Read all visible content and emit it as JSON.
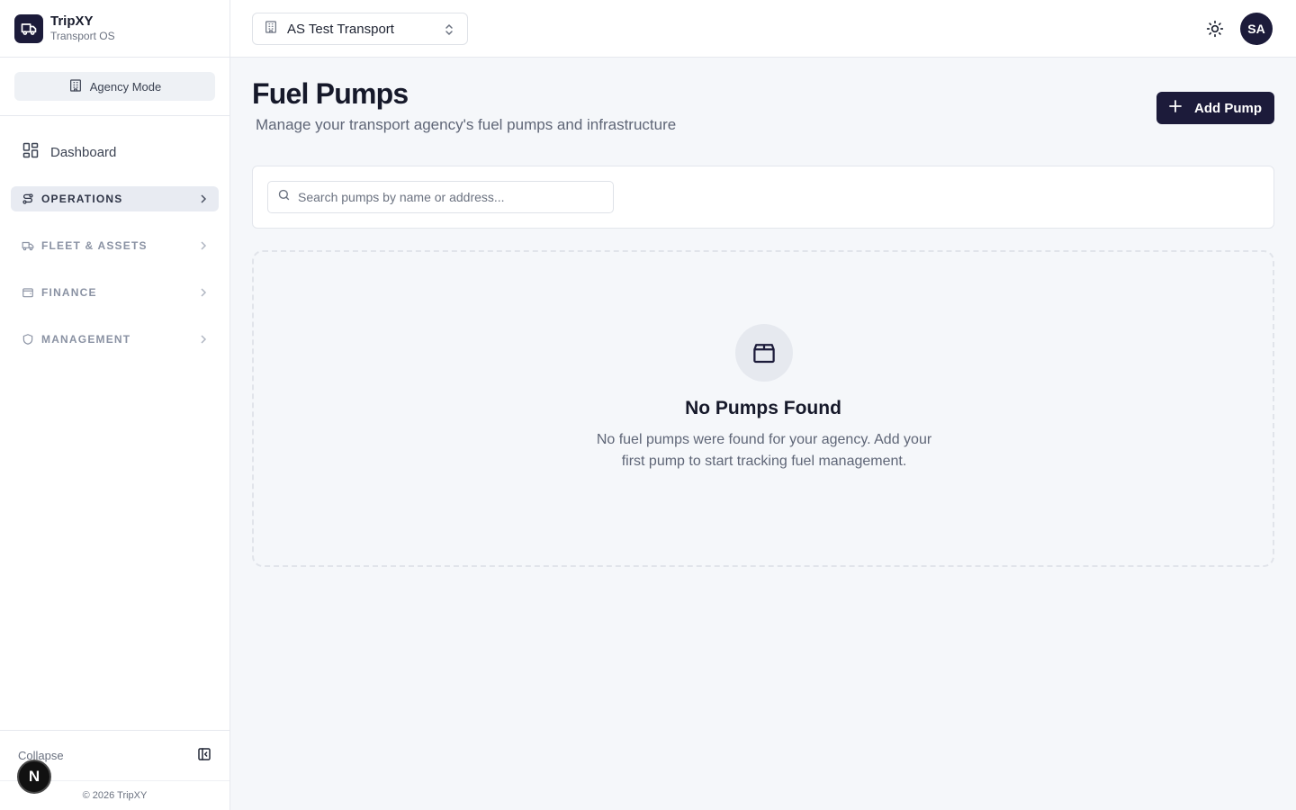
{
  "brand": {
    "name": "TripXY",
    "subtitle": "Transport OS"
  },
  "mode": {
    "label": "Agency Mode"
  },
  "sidebar": {
    "dashboard_label": "Dashboard",
    "groups": [
      {
        "label": "OPERATIONS",
        "active": true,
        "icon": "route-icon"
      },
      {
        "label": "FLEET & ASSETS",
        "active": false,
        "icon": "truck-icon"
      },
      {
        "label": "FINANCE",
        "active": false,
        "icon": "wallet-icon"
      },
      {
        "label": "MANAGEMENT",
        "active": false,
        "icon": "shield-icon"
      }
    ],
    "collapse_label": "Collapse",
    "copyright": "© 2026 TripXY",
    "badge_letter": "N"
  },
  "topbar": {
    "agency_select_value": "AS Test Transport",
    "avatar_initials": "SA"
  },
  "main": {
    "title": "Fuel Pumps",
    "subtitle": "Manage your transport agency's fuel pumps and infrastructure",
    "add_button_label": "Add Pump",
    "search_placeholder": "Search pumps by name or address...",
    "empty_title": "No Pumps Found",
    "empty_description": "No fuel pumps were found for your agency. Add your first pump to start tracking fuel management."
  },
  "colors": {
    "primary": "#1c1b3a",
    "background": "#f5f7fa",
    "active_nav": "#e8ebf2"
  }
}
